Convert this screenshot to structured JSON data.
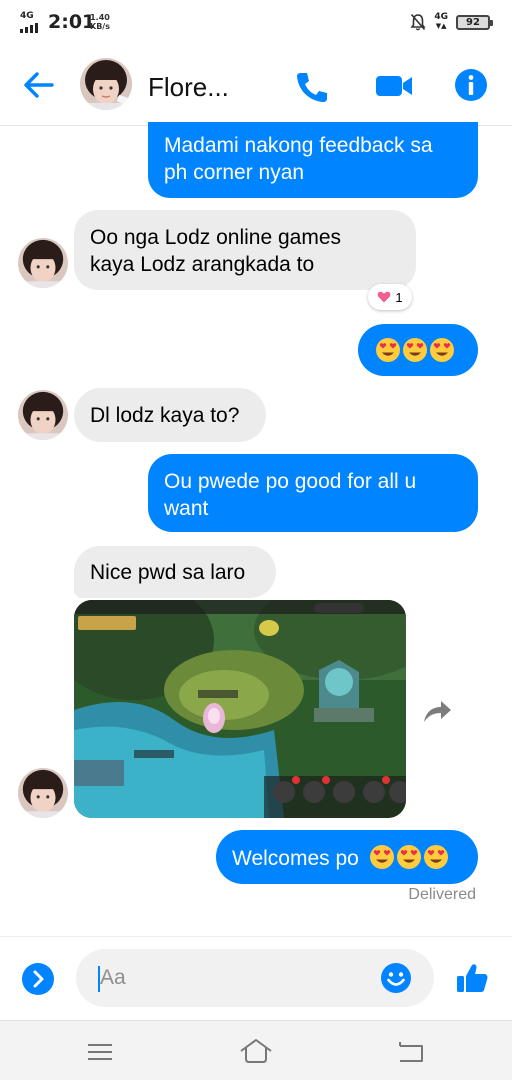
{
  "status_bar": {
    "network_left": "4G",
    "time": "2:01",
    "speed_value": "1.40",
    "speed_unit": "KB/s",
    "network_right": "4G",
    "battery": "92"
  },
  "header": {
    "contact_name": "Flore...",
    "accent_color": "#0084ff"
  },
  "messages": [
    {
      "direction": "out",
      "text_lines": [
        "Madami nakong feedback sa",
        "ph corner nyan"
      ]
    },
    {
      "direction": "in",
      "text_lines": [
        "Oo nga Lodz online games",
        "kaya Lodz arangkada to"
      ],
      "reaction": {
        "emoji": "heart",
        "count": "1"
      }
    },
    {
      "direction": "out",
      "emoji_only": [
        "heart-eyes",
        "heart-eyes",
        "heart-eyes"
      ]
    },
    {
      "direction": "in",
      "text": "Dl lodz kaya to?"
    },
    {
      "direction": "out",
      "text_lines": [
        "Ou pwede po good for all u",
        "want"
      ]
    },
    {
      "direction": "in",
      "text": "Nice pwd sa laro"
    },
    {
      "direction": "in",
      "type": "image",
      "image_label": "game screenshot"
    },
    {
      "direction": "out",
      "text": "Welcomes po",
      "trailing_emojis": [
        "heart-eyes",
        "heart-eyes",
        "heart-eyes"
      ]
    }
  ],
  "delivery_status": "Delivered",
  "composer": {
    "placeholder": "Aa"
  },
  "icons": [
    "back-arrow-icon",
    "phone-icon",
    "video-camera-icon",
    "info-icon",
    "heart-icon",
    "share-arrow-icon",
    "chevron-right-icon",
    "smiley-icon",
    "thumbs-up-icon",
    "menu-icon",
    "home-icon",
    "back-icon"
  ]
}
